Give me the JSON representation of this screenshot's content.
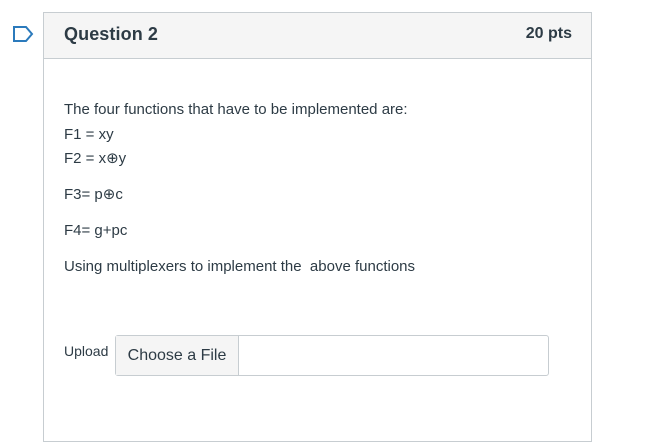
{
  "question": {
    "title": "Question 2",
    "points": "20 pts",
    "body_lines": [
      "The four functions that have to be implemented are:",
      "F1 = xy",
      "F2 = x⊕y",
      "F3= p⊕c",
      "F4= g+pc",
      "Using multiplexers to implement the  above functions"
    ]
  },
  "upload": {
    "label": "Upload",
    "button_label": "Choose a File"
  },
  "icons": {
    "flag": "bookmark-flag-icon"
  },
  "colors": {
    "flag": "#2b7abc",
    "text": "#2d3b45",
    "header_bg": "#f5f5f5",
    "border": "#c7cdd1"
  }
}
